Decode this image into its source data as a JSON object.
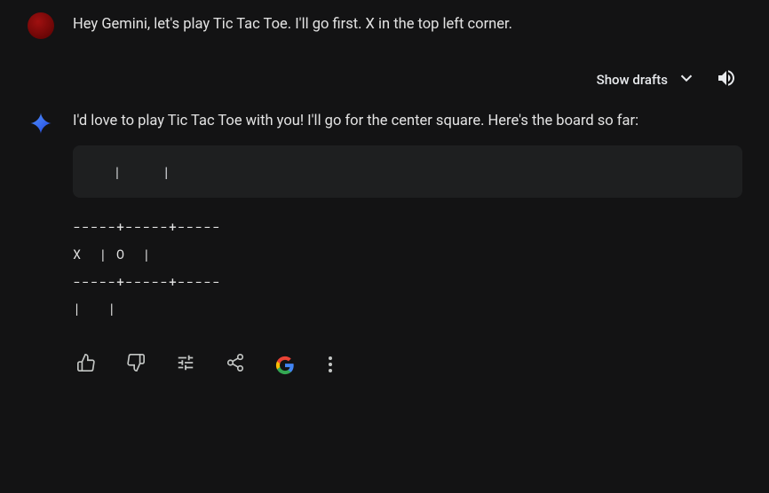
{
  "user": {
    "text": "Hey Gemini, let's play Tic Tac Toe. I'll go first. X in the top left corner."
  },
  "drafts": {
    "label": "Show drafts"
  },
  "response": {
    "text": "I'd love to play Tic Tac Toe with you!  I'll go for the center square.  Here's the board so far:",
    "code": "   |     |",
    "board": "-----+-----+-----\nX  | O  |\n-----+-----+-----\n|   |"
  },
  "icons": {
    "chevron": "chevron-down",
    "speaker": "volume-up",
    "thumbsUp": "thumb-up",
    "thumbsDown": "thumb-down",
    "tune": "tune",
    "share": "share",
    "google": "google-g",
    "more": "more-vert"
  }
}
